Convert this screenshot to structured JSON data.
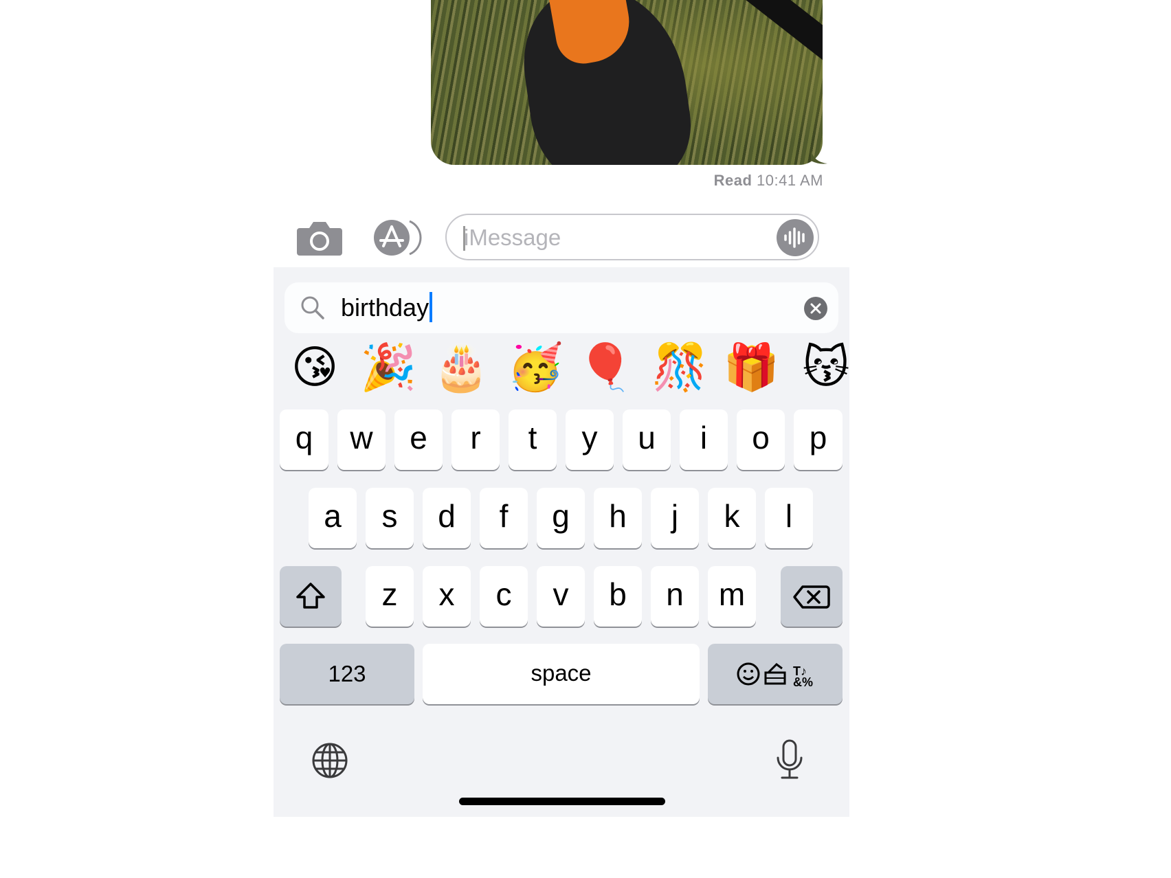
{
  "conversation": {
    "read_status_label": "Read",
    "read_time": "10:41 AM"
  },
  "compose": {
    "placeholder": "iMessage"
  },
  "emoji_search": {
    "query": "birthday",
    "results": [
      "😘",
      "🎉",
      "🎂",
      "🥳",
      "🎈",
      "🎊",
      "🎁",
      "😽"
    ]
  },
  "keyboard": {
    "row1": [
      "q",
      "w",
      "e",
      "r",
      "t",
      "y",
      "u",
      "i",
      "o",
      "p"
    ],
    "row2": [
      "a",
      "s",
      "d",
      "f",
      "g",
      "h",
      "j",
      "k",
      "l"
    ],
    "row3": [
      "z",
      "x",
      "c",
      "v",
      "b",
      "n",
      "m"
    ],
    "numbers_label": "123",
    "space_label": "space",
    "symbols_glyph": "&%"
  }
}
